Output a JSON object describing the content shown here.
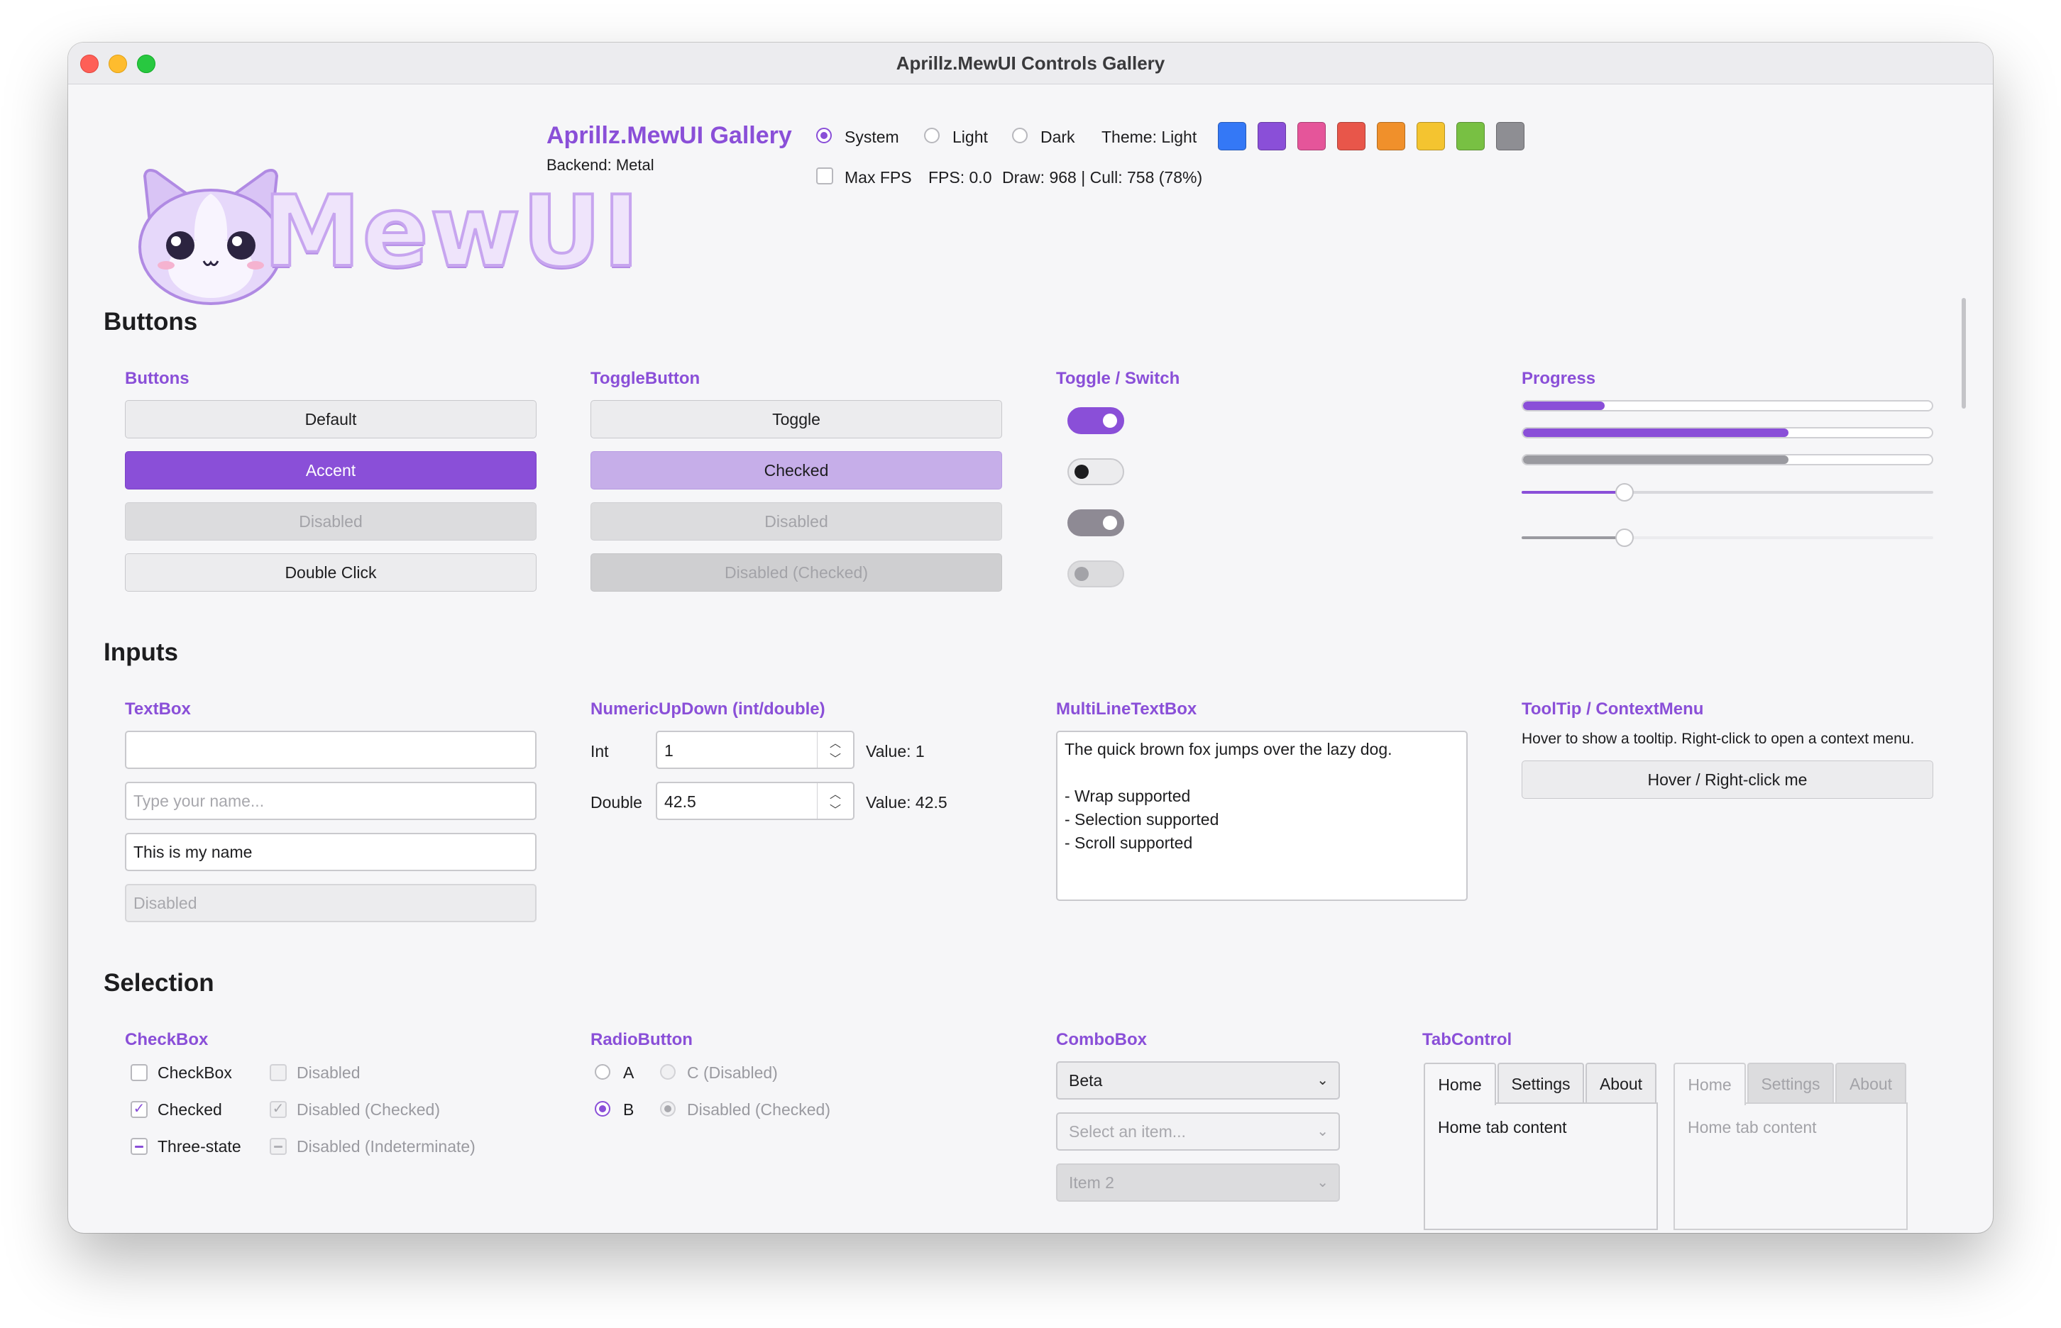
{
  "window": {
    "title": "Aprillz.MewUI Controls Gallery"
  },
  "header": {
    "logo_text": "MewUI",
    "app_title": "Aprillz.MewUI Gallery",
    "backend": "Backend: Metal",
    "theme_options": [
      "System",
      "Light",
      "Dark"
    ],
    "theme_selected": "System",
    "theme_label": "Theme: Light",
    "swatches": [
      "#3478f6",
      "#8a4fd8",
      "#e5559a",
      "#e8564a",
      "#f0902b",
      "#f4c430",
      "#78c043",
      "#8e8e93"
    ],
    "max_fps_label": "Max FPS",
    "max_fps_checked": false,
    "fps": "FPS: 0.0",
    "draw_stats": "Draw: 968 | Cull: 758 (78%)"
  },
  "sections": {
    "buttons": "Buttons",
    "inputs": "Inputs",
    "selection": "Selection"
  },
  "buttons": {
    "title": "Buttons",
    "default": "Default",
    "accent": "Accent",
    "disabled": "Disabled",
    "double_click": "Double Click"
  },
  "toggle_button": {
    "title": "ToggleButton",
    "toggle": "Toggle",
    "checked": "Checked",
    "disabled": "Disabled",
    "disabled_checked": "Disabled (Checked)"
  },
  "toggle_switch": {
    "title": "Toggle / Switch",
    "states": [
      {
        "on": true,
        "enabled": true
      },
      {
        "on": false,
        "enabled": true
      },
      {
        "on": true,
        "enabled": false
      },
      {
        "on": false,
        "enabled": false
      }
    ]
  },
  "progress": {
    "title": "Progress",
    "bars": [
      0.2,
      0.65,
      0.65
    ],
    "sliders": [
      0.25,
      0.25
    ],
    "accent": "#8a4fd8",
    "muted": "#9a9aa0"
  },
  "textbox": {
    "title": "TextBox",
    "empty_value": "",
    "placeholder": "Type your name...",
    "value": "This is my name",
    "disabled": "Disabled"
  },
  "numeric": {
    "title": "NumericUpDown (int/double)",
    "int_label": "Int",
    "int_value": "1",
    "int_readout": "Value: 1",
    "double_label": "Double",
    "double_value": "42.5",
    "double_readout": "Value: 42.5"
  },
  "multiline": {
    "title": "MultiLineTextBox",
    "lines": [
      "The quick brown fox jumps over the lazy dog.",
      "",
      "- Wrap supported",
      "- Selection supported",
      "- Scroll supported"
    ]
  },
  "tooltip": {
    "title": "ToolTip / ContextMenu",
    "hint": "Hover to show a tooltip. Right-click to open a context menu.",
    "button": "Hover / Right-click me"
  },
  "checkbox": {
    "title": "CheckBox",
    "items": [
      {
        "label": "CheckBox",
        "state": "unchecked",
        "enabled": true
      },
      {
        "label": "Disabled",
        "state": "unchecked",
        "enabled": false
      },
      {
        "label": "Checked",
        "state": "checked",
        "enabled": true
      },
      {
        "label": "Disabled (Checked)",
        "state": "checked",
        "enabled": false
      },
      {
        "label": "Three-state",
        "state": "indeterminate",
        "enabled": true
      },
      {
        "label": "Disabled (Indeterminate)",
        "state": "indeterminate",
        "enabled": false
      }
    ]
  },
  "radio": {
    "title": "RadioButton",
    "a": "A",
    "c": "C (Disabled)",
    "b": "B",
    "disabled_checked": "Disabled (Checked)"
  },
  "combobox": {
    "title": "ComboBox",
    "selected": "Beta",
    "placeholder": "Select an item...",
    "disabled_value": "Item 2"
  },
  "tabcontrol": {
    "title": "TabControl",
    "tabs": [
      "Home",
      "Settings",
      "About"
    ],
    "content": "Home tab content"
  }
}
